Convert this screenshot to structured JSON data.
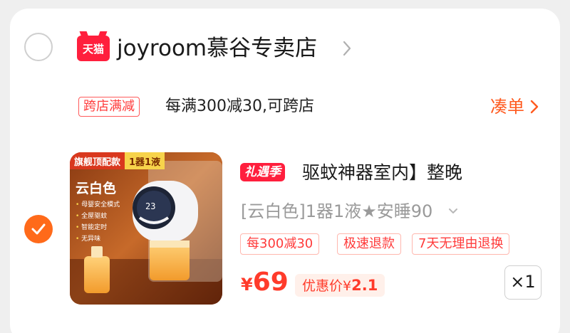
{
  "store": {
    "logo_label": "天猫",
    "name": "joyroom慕谷专卖店",
    "promo_tag": "跨店满减",
    "promo_text": "每满300减30,可跨店",
    "coudan_label": "凑单"
  },
  "product": {
    "thumb_flag_1": "旗舰顶配款",
    "thumb_flag_2": "1器1液",
    "thumb_color": "云白色",
    "thumb_features": [
      "母婴安全模式",
      "全屋驱蚊",
      "智能定时",
      "无异味"
    ],
    "title_badge": "礼遇季",
    "title": "驱蚊神器室内】整晚",
    "sku": "[云白色]1器1液★安睡90",
    "chips": [
      "每300减30",
      "极速退款",
      "7天无理由退换"
    ],
    "price_symbol": "¥",
    "price": "69",
    "deal_label": "优惠价",
    "deal_symbol": "¥",
    "deal_price": "2.1",
    "quantity": "×1"
  },
  "colors": {
    "accent": "#ff6a1a",
    "price_red": "#ff3b2b",
    "tmall_red": "#ff1f3d"
  }
}
